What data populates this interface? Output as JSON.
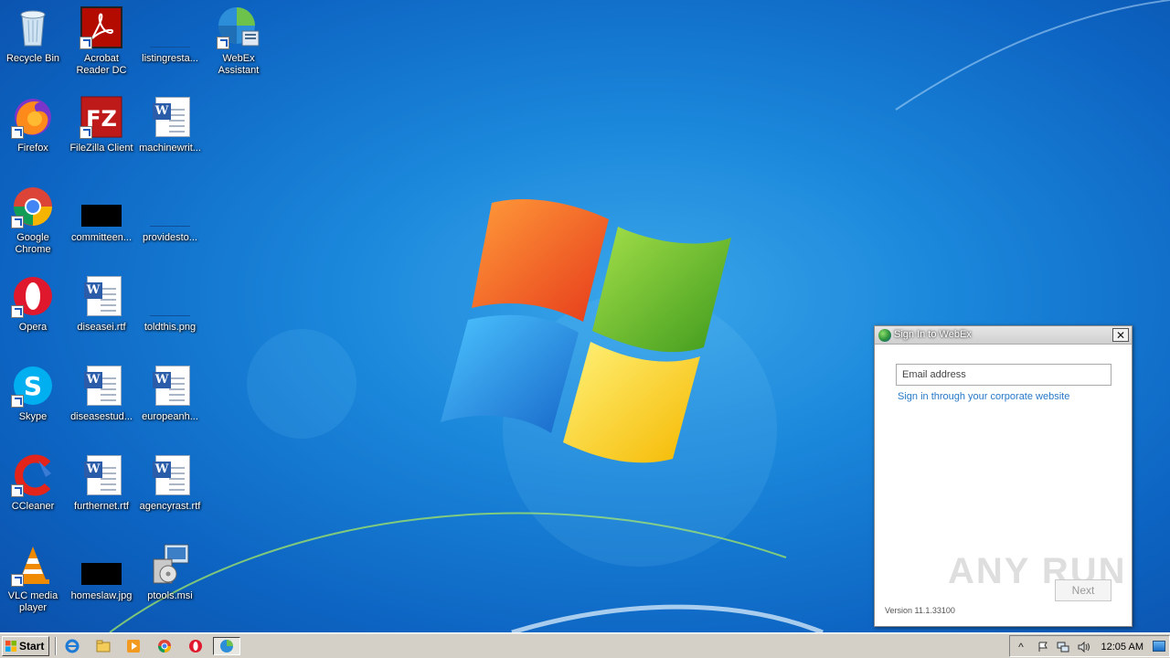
{
  "desktop": {
    "icons": [
      {
        "label": "Recycle Bin",
        "icon": "recycle-bin-icon"
      },
      {
        "label": "Acrobat Reader DC",
        "icon": "acrobat-icon"
      },
      {
        "label": "listingresta...",
        "icon": "image-file-icon"
      },
      {
        "label": "WebEx Assistant",
        "icon": "webex-icon"
      },
      {
        "label": "Firefox",
        "icon": "firefox-icon"
      },
      {
        "label": "FileZilla Client",
        "icon": "filezilla-icon"
      },
      {
        "label": "machinewrit...",
        "icon": "word-doc-icon"
      },
      {
        "label": "Google Chrome",
        "icon": "chrome-icon"
      },
      {
        "label": "committeen...",
        "icon": "image-file-icon"
      },
      {
        "label": "providesto...",
        "icon": "image-file-icon"
      },
      {
        "label": "Opera",
        "icon": "opera-icon"
      },
      {
        "label": "diseasei.rtf",
        "icon": "word-doc-icon"
      },
      {
        "label": "toldthis.png",
        "icon": "image-file-icon"
      },
      {
        "label": "Skype",
        "icon": "skype-icon"
      },
      {
        "label": "diseasestud...",
        "icon": "word-doc-icon"
      },
      {
        "label": "europeanh...",
        "icon": "word-doc-icon"
      },
      {
        "label": "CCleaner",
        "icon": "ccleaner-icon"
      },
      {
        "label": "furthernet.rtf",
        "icon": "word-doc-icon"
      },
      {
        "label": "agencyrast.rtf",
        "icon": "word-doc-icon"
      },
      {
        "label": "VLC media player",
        "icon": "vlc-icon"
      },
      {
        "label": "homeslaw.jpg",
        "icon": "image-file-icon"
      },
      {
        "label": "ptools.msi",
        "icon": "installer-icon"
      }
    ]
  },
  "dialog": {
    "title": "Sign In to WebEx",
    "close_glyph": "✕",
    "email_placeholder": "Email address",
    "email_value": "",
    "corporate_link": "Sign in through your corporate website",
    "next_label": "Next",
    "version": "Version 11.1.33100",
    "watermark": "ANY RUN"
  },
  "taskbar": {
    "start_label": "Start",
    "quick_launch": [
      "ie-icon",
      "explorer-icon",
      "media-player-icon",
      "chrome-icon",
      "opera-icon"
    ],
    "active_task": "webex-icon",
    "tray": {
      "expand_glyph": "^",
      "icons": [
        "flag-icon",
        "network-icon",
        "volume-icon"
      ],
      "time": "12:05 AM"
    }
  },
  "colors": {
    "desktop_blue": "#1a86da",
    "taskbar": "#d4d0c8",
    "link": "#2778c8"
  }
}
